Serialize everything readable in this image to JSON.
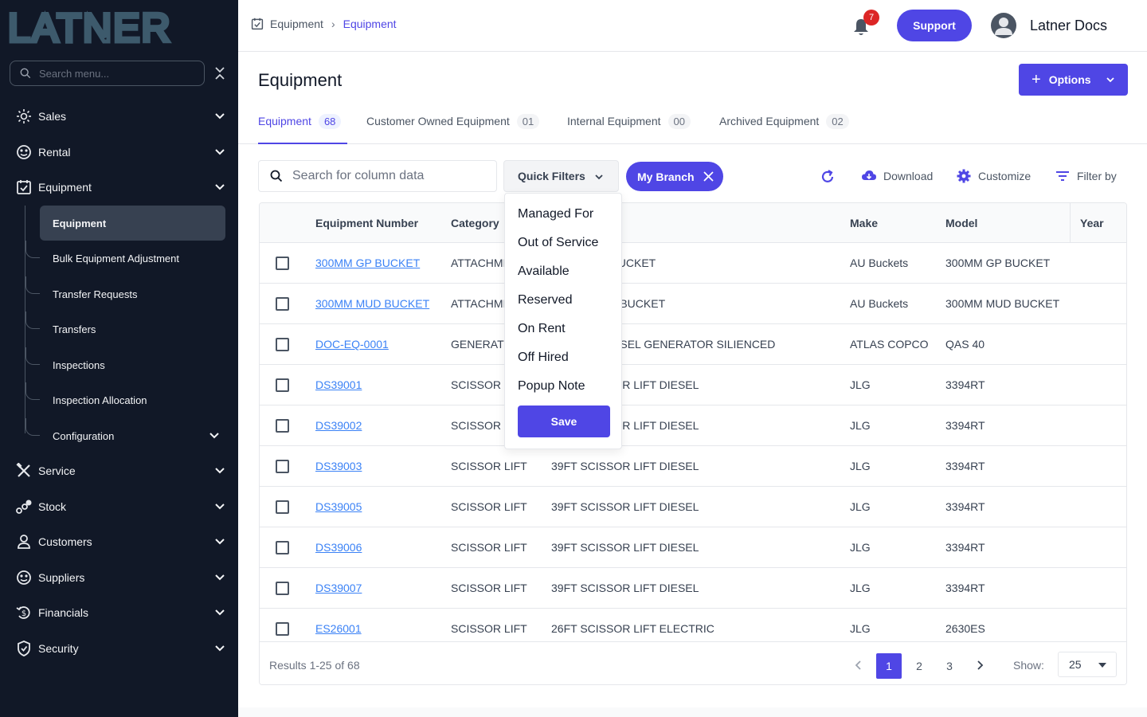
{
  "app": {
    "logo_text": "LATNER"
  },
  "sidebar": {
    "search_placeholder": "Search menu...",
    "items": [
      {
        "label": "Sales",
        "icon": "sales-icon"
      },
      {
        "label": "Rental",
        "icon": "rental-icon"
      },
      {
        "label": "Equipment",
        "icon": "equipment-icon"
      },
      {
        "label": "Service",
        "icon": "service-icon"
      },
      {
        "label": "Stock",
        "icon": "stock-icon"
      },
      {
        "label": "Customers",
        "icon": "person-icon"
      },
      {
        "label": "Suppliers",
        "icon": "suppliers-icon"
      },
      {
        "label": "Financials",
        "icon": "financials-icon"
      },
      {
        "label": "Security",
        "icon": "shield-icon"
      }
    ],
    "equipment_sub": [
      {
        "label": "Equipment"
      },
      {
        "label": "Bulk Equipment Adjustment"
      },
      {
        "label": "Transfer Requests"
      },
      {
        "label": "Transfers"
      },
      {
        "label": "Inspections"
      },
      {
        "label": "Inspection Allocation"
      },
      {
        "label": "Configuration"
      }
    ]
  },
  "topbar": {
    "breadcrumb": [
      "Equipment",
      "Equipment"
    ],
    "notification_count": "7",
    "support_label": "Support",
    "user_name": "Latner Docs"
  },
  "page": {
    "title": "Equipment",
    "options_label": "Options",
    "tabs": [
      {
        "label": "Equipment",
        "count": "68"
      },
      {
        "label": "Customer Owned Equipment",
        "count": "01"
      },
      {
        "label": "Internal Equipment",
        "count": "00"
      },
      {
        "label": "Archived Equipment",
        "count": "02"
      }
    ]
  },
  "toolbar": {
    "search_placeholder": "Search for column data",
    "quick_filters_label": "Quick Filters",
    "branch_chip": "My Branch",
    "download_label": "Download",
    "customize_label": "Customize",
    "filter_label": "Filter by"
  },
  "quick_filters": {
    "options": [
      "Managed For",
      "Out of Service",
      "Available",
      "Reserved",
      "On Rent",
      "Off Hired",
      "Popup Note"
    ],
    "save_label": "Save"
  },
  "table": {
    "columns": [
      "Equipment Number",
      "Category",
      "",
      "Make",
      "Model",
      "Year"
    ],
    "rows": [
      [
        "300MM GP BUCKET",
        "ATTACHMENT",
        "300MM GP BUCKET",
        "AU Buckets",
        "300MM GP BUCKET"
      ],
      [
        "300MM MUD BUCKET",
        "ATTACHMENT",
        "300MM MUD BUCKET",
        "AU Buckets",
        "300MM MUD BUCKET"
      ],
      [
        "DOC-EQ-0001",
        "GENERATOR",
        "3 PHASE DIESEL GENERATOR SILIENCED",
        "ATLAS COPCO",
        "QAS 40"
      ],
      [
        "DS39001",
        "SCISSOR LIFT",
        "39FT SCISSOR LIFT DIESEL",
        "JLG",
        "3394RT"
      ],
      [
        "DS39002",
        "SCISSOR LIFT",
        "39FT SCISSOR LIFT DIESEL",
        "JLG",
        "3394RT"
      ],
      [
        "DS39003",
        "SCISSOR LIFT",
        "39FT SCISSOR LIFT DIESEL",
        "JLG",
        "3394RT"
      ],
      [
        "DS39005",
        "SCISSOR LIFT",
        "39FT SCISSOR LIFT DIESEL",
        "JLG",
        "3394RT"
      ],
      [
        "DS39006",
        "SCISSOR LIFT",
        "39FT SCISSOR LIFT DIESEL",
        "JLG",
        "3394RT"
      ],
      [
        "DS39007",
        "SCISSOR LIFT",
        "39FT SCISSOR LIFT DIESEL",
        "JLG",
        "3394RT"
      ],
      [
        "ES26001",
        "SCISSOR LIFT",
        "26FT SCISSOR LIFT ELECTRIC",
        "JLG",
        "2630ES"
      ]
    ],
    "results_text": "Results 1-25 of 68",
    "pages": [
      "1",
      "2",
      "3"
    ],
    "show_label": "Show:",
    "show_value": "25"
  }
}
